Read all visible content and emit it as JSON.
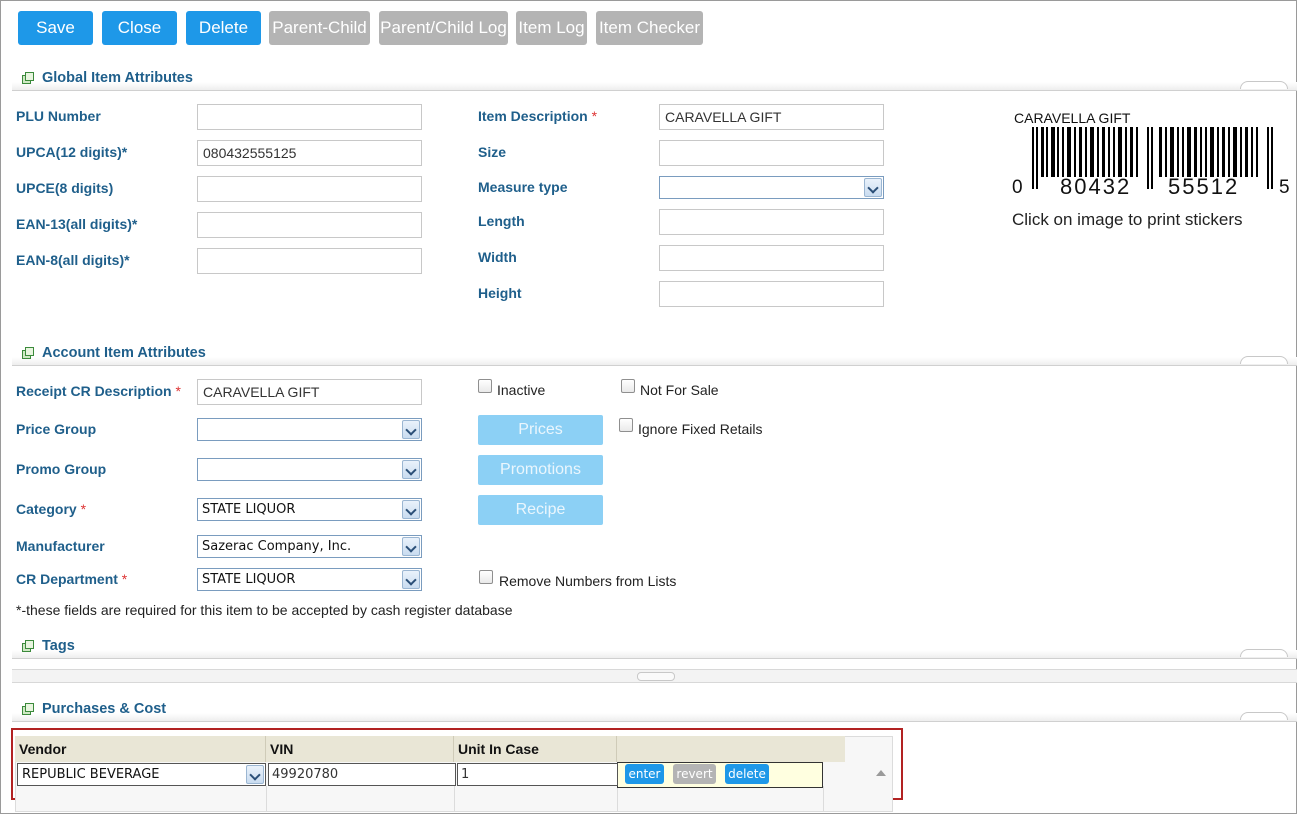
{
  "toolbar": {
    "save": "Save",
    "close": "Close",
    "delete": "Delete",
    "parent_child": "Parent-Child",
    "parent_child_log": "Parent/Child Log",
    "item_log": "Item Log",
    "item_checker": "Item Checker"
  },
  "global": {
    "title": "Global Item Attributes",
    "plu_label": "PLU Number",
    "plu_value": "",
    "upca_label": "UPCA(12 digits)*",
    "upca_value": "080432555125",
    "upce_label": "UPCE(8 digits)",
    "upce_value": "",
    "ean13_label": "EAN-13(all digits)*",
    "ean13_value": "",
    "ean8_label": "EAN-8(all digits)*",
    "ean8_value": "",
    "desc_label": "Item Description",
    "desc_req": "*",
    "desc_value": "CARAVELLA GIFT",
    "size_label": "Size",
    "size_value": "",
    "measure_label": "Measure type",
    "measure_value": "",
    "length_label": "Length",
    "width_label": "Width",
    "height_label": "Height"
  },
  "barcode": {
    "caption": "CARAVELLA GIFT",
    "digit_left": "0",
    "digits_group1": "80432",
    "digits_group2": "55512",
    "digit_right": "5",
    "print_hint": "Click on image to print stickers"
  },
  "account": {
    "title": "Account Item Attributes",
    "receipt_label": "Receipt CR Description",
    "receipt_req": "*",
    "receipt_value": "CARAVELLA GIFT",
    "price_group_label": "Price Group",
    "price_group_value": "",
    "promo_group_label": "Promo Group",
    "promo_group_value": "",
    "category_label": "Category",
    "category_req": "*",
    "category_value": "STATE LIQUOR",
    "manufacturer_label": "Manufacturer",
    "manufacturer_value": "Sazerac Company, Inc.",
    "cr_dept_label": "CR Department",
    "cr_dept_req": "*",
    "cr_dept_value": "STATE LIQUOR",
    "inactive": "Inactive",
    "not_for_sale": "Not For Sale",
    "ignore_fixed": "Ignore Fixed Retails",
    "remove_numbers": "Remove Numbers from Lists",
    "prices_btn": "Prices",
    "promotions_btn": "Promotions",
    "recipe_btn": "Recipe",
    "footnote": "*-these fields are required for this item to be accepted by cash register database"
  },
  "tags": {
    "title": "Tags"
  },
  "purchases": {
    "title": "Purchases & Cost",
    "columns": [
      "Vendor",
      "VIN",
      "Unit In Case"
    ],
    "row": {
      "vendor": "REPUBLIC BEVERAGE",
      "vin": "49920780",
      "unit_in_case": "1"
    },
    "enter": "enter",
    "revert": "revert",
    "delete": "delete"
  },
  "colors": {
    "accent": "#1e98e8",
    "label": "#1f5f8b",
    "disabled": "#b4b4b4",
    "highlight_border": "#b22222"
  }
}
